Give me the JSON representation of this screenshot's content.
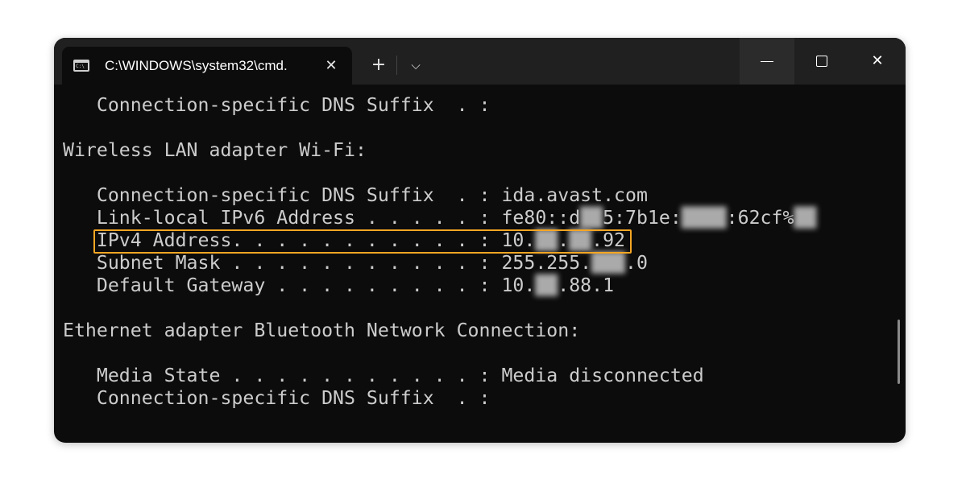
{
  "window": {
    "tab_title": "C:\\WINDOWS\\system32\\cmd.",
    "new_tab_glyph": "+",
    "dropdown_glyph": "⌵",
    "close_tab_glyph": "✕",
    "close_window_glyph": "✕"
  },
  "terminal": {
    "lines": [
      "   Connection-specific DNS Suffix  . :",
      "Wireless LAN adapter Wi-Fi:",
      "   Connection-specific DNS Suffix  . : ida.avast.com",
      "   Link-local IPv6 Address . . . . . : fe80::d",
      "   IPv4 Address. . . . . . . . . . . : 10.",
      "   Subnet Mask . . . . . . . . . . . : 255.255.",
      "   Default Gateway . . . . . . . . . : 10.",
      "Ethernet adapter Bluetooth Network Connection:",
      "   Media State . . . . . . . . . . . : Media disconnected",
      "   Connection-specific DNS Suffix  . :"
    ],
    "ipv6_parts": [
      "5:7b1e:",
      ":62cf%"
    ],
    "ipv4_tail": ".92",
    "subnet_tail": ".0",
    "gateway_tail": ".88.1"
  },
  "colors": {
    "terminal_bg": "#0c0c0c",
    "text": "#cccccc",
    "highlight": "#f5a623",
    "titlebar_bg": "#202020"
  }
}
